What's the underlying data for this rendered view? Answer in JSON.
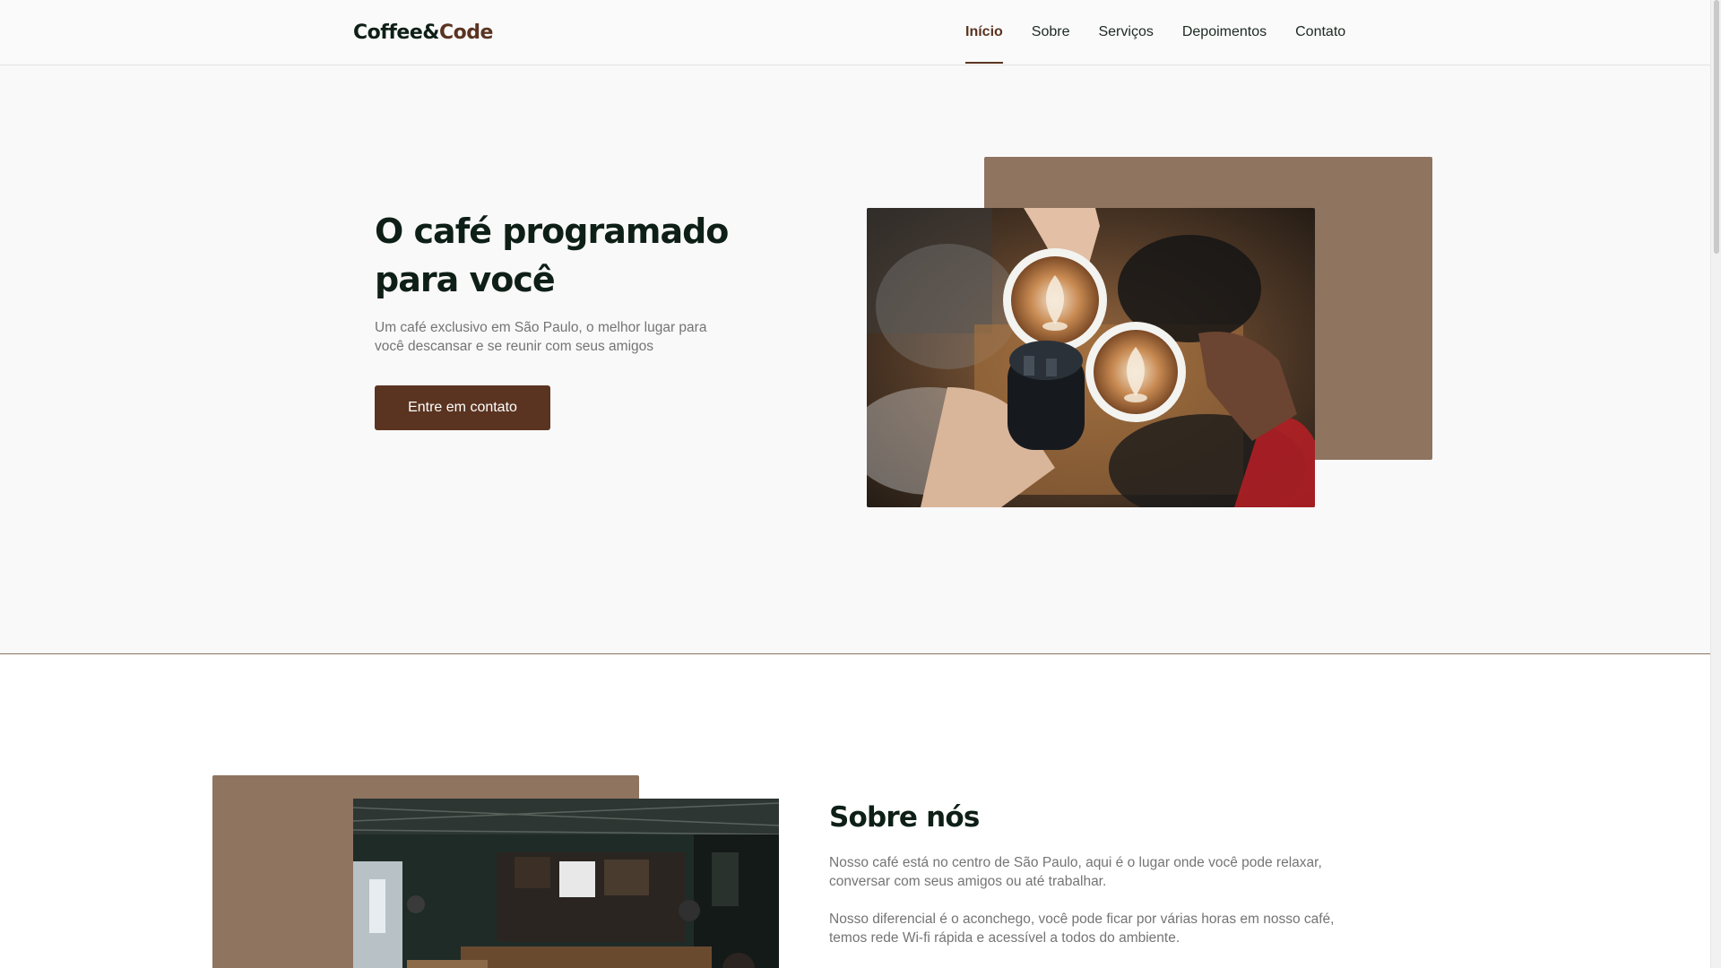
{
  "header": {
    "logo_part1": "Coffee&",
    "logo_part2": "Code",
    "nav": [
      "Início",
      "Sobre",
      "Serviços",
      "Depoimentos",
      "Contato"
    ],
    "active_nav": "Início"
  },
  "hero": {
    "title": "O café programado para você",
    "description": "Um café exclusivo em São Paulo, o melhor lugar para você descansar e se reunir com seus amigos",
    "cta_label": "Entre em contato"
  },
  "about": {
    "title": "Sobre nós",
    "paragraph1": "Nosso café está no centro de São Paulo, aqui é o lugar onde você pode relaxar, conversar com seus amigos ou até trabalhar.",
    "paragraph2": "Nosso diferencial é o aconchego, você pode ficar por várias horas em nosso café, temos rede Wi-fi rápida e acessível a todos do ambiente."
  },
  "colors": {
    "brand": "#5a3421",
    "backdrop": "#8f7460",
    "heading": "#0e1f17",
    "body_text": "#747474"
  }
}
